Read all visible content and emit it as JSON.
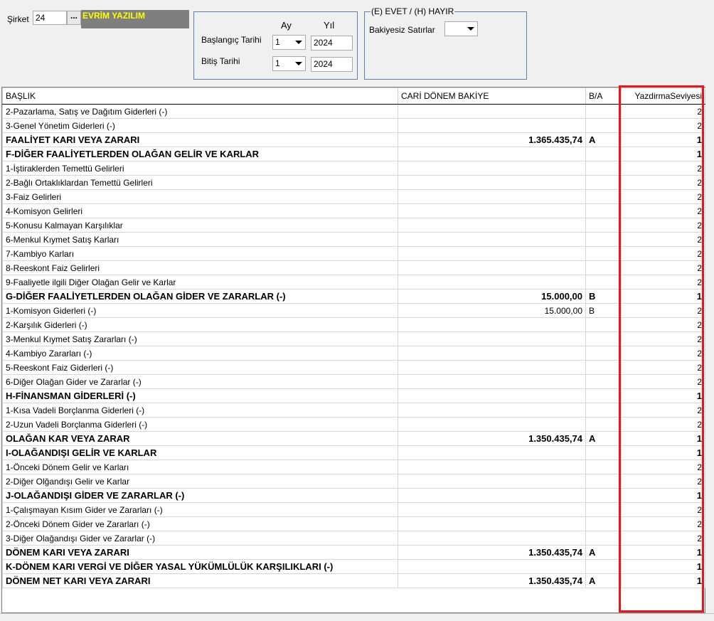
{
  "filters": {
    "sirket_label": "Şirket",
    "sirket_value": "24",
    "sirket_button": "...",
    "company_name": "EVRİM YAZILIM",
    "ay_label": "Ay",
    "yil_label": "Yıl",
    "baslangic_label": "Başlangıç Tarihi",
    "bitis_label": "Bitiş Tarihi",
    "baslangic_ay": "1",
    "baslangic_yil": "2024",
    "bitis_ay": "1",
    "bitis_yil": "2024",
    "evet_hayir_title": "(E) EVET / (H) HAYIR",
    "bakiyesiz_label": "Bakiyesiz Satırlar",
    "bakiyesiz_value": ""
  },
  "table": {
    "headers": [
      "BAŞLIK",
      "CARİ DÖNEM BAKİYE",
      "B/A",
      "YazdirmaSeviyesi"
    ],
    "rows": [
      {
        "baslik": "2-Pazarlama, Satış ve Dağıtım Giderleri (-)",
        "bakiye": "",
        "ba": "",
        "seviye": "2",
        "bold": false
      },
      {
        "baslik": "3-Genel Yönetim Giderleri (-)",
        "bakiye": "",
        "ba": "",
        "seviye": "2",
        "bold": false
      },
      {
        "baslik": "FAALİYET KARI VEYA ZARARI",
        "bakiye": "1.365.435,74",
        "ba": "A",
        "seviye": "1",
        "bold": true
      },
      {
        "baslik": "F-DİĞER FAALİYETLERDEN OLAĞAN GELİR VE KARLAR",
        "bakiye": "",
        "ba": "",
        "seviye": "1",
        "bold": true
      },
      {
        "baslik": "1-İştiraklerden Temettü Gelirleri",
        "bakiye": "",
        "ba": "",
        "seviye": "2",
        "bold": false
      },
      {
        "baslik": "2-Bağlı Ortaklıklardan Temettü Gelirleri",
        "bakiye": "",
        "ba": "",
        "seviye": "2",
        "bold": false
      },
      {
        "baslik": "3-Faiz Gelirleri",
        "bakiye": "",
        "ba": "",
        "seviye": "2",
        "bold": false
      },
      {
        "baslik": "4-Komisyon Gelirleri",
        "bakiye": "",
        "ba": "",
        "seviye": "2",
        "bold": false
      },
      {
        "baslik": "5-Konusu Kalmayan Karşılıklar",
        "bakiye": "",
        "ba": "",
        "seviye": "2",
        "bold": false
      },
      {
        "baslik": "6-Menkul Kıymet Satış Karları",
        "bakiye": "",
        "ba": "",
        "seviye": "2",
        "bold": false
      },
      {
        "baslik": "7-Kambiyo Karları",
        "bakiye": "",
        "ba": "",
        "seviye": "2",
        "bold": false
      },
      {
        "baslik": "8-Reeskont Faiz Gelirleri",
        "bakiye": "",
        "ba": "",
        "seviye": "2",
        "bold": false
      },
      {
        "baslik": "9-Faaliyetle ilgili Diğer Olağan Gelir ve Karlar",
        "bakiye": "",
        "ba": "",
        "seviye": "2",
        "bold": false
      },
      {
        "baslik": "G-DİĞER FAALİYETLERDEN OLAĞAN GİDER VE ZARARLAR (-)",
        "bakiye": "15.000,00",
        "ba": "B",
        "seviye": "1",
        "bold": true
      },
      {
        "baslik": "1-Komisyon Giderleri (-)",
        "bakiye": "15.000,00",
        "ba": "B",
        "seviye": "2",
        "bold": false
      },
      {
        "baslik": "2-Karşılık Giderleri (-)",
        "bakiye": "",
        "ba": "",
        "seviye": "2",
        "bold": false
      },
      {
        "baslik": "3-Menkul Kıymet Satış Zararları (-)",
        "bakiye": "",
        "ba": "",
        "seviye": "2",
        "bold": false
      },
      {
        "baslik": "4-Kambiyo Zararları (-)",
        "bakiye": "",
        "ba": "",
        "seviye": "2",
        "bold": false
      },
      {
        "baslik": "5-Reeskont Faiz Giderleri (-)",
        "bakiye": "",
        "ba": "",
        "seviye": "2",
        "bold": false
      },
      {
        "baslik": "6-Diğer Olağan Gider ve Zararlar (-)",
        "bakiye": "",
        "ba": "",
        "seviye": "2",
        "bold": false
      },
      {
        "baslik": "H-FİNANSMAN GİDERLERİ (-)",
        "bakiye": "",
        "ba": "",
        "seviye": "1",
        "bold": true
      },
      {
        "baslik": "1-Kısa Vadeli Borçlanma Giderleri (-)",
        "bakiye": "",
        "ba": "",
        "seviye": "2",
        "bold": false
      },
      {
        "baslik": "2-Uzun Vadeli Borçlanma Giderleri (-)",
        "bakiye": "",
        "ba": "",
        "seviye": "2",
        "bold": false
      },
      {
        "baslik": "OLAĞAN KAR VEYA ZARAR",
        "bakiye": "1.350.435,74",
        "ba": "A",
        "seviye": "1",
        "bold": true
      },
      {
        "baslik": "I-OLAĞANDIŞI GELİR VE KARLAR",
        "bakiye": "",
        "ba": "",
        "seviye": "1",
        "bold": true
      },
      {
        "baslik": "1-Önceki Dönem Gelir ve Karları",
        "bakiye": "",
        "ba": "",
        "seviye": "2",
        "bold": false
      },
      {
        "baslik": "2-Diğer Olğandışı Gelir ve Karlar",
        "bakiye": "",
        "ba": "",
        "seviye": "2",
        "bold": false
      },
      {
        "baslik": "J-OLAĞANDIŞI GİDER VE ZARARLAR (-)",
        "bakiye": "",
        "ba": "",
        "seviye": "1",
        "bold": true
      },
      {
        "baslik": "1-Çalışmayan Kısım Gider ve Zararları (-)",
        "bakiye": "",
        "ba": "",
        "seviye": "2",
        "bold": false
      },
      {
        "baslik": "2-Önceki Dönem Gider ve Zararları (-)",
        "bakiye": "",
        "ba": "",
        "seviye": "2",
        "bold": false
      },
      {
        "baslik": "3-Diğer Olağandışı Gider ve Zararlar (-)",
        "bakiye": "",
        "ba": "",
        "seviye": "2",
        "bold": false
      },
      {
        "baslik": "DÖNEM KARI VEYA ZARARI",
        "bakiye": "1.350.435,74",
        "ba": "A",
        "seviye": "1",
        "bold": true
      },
      {
        "baslik": "K-DÖNEM KARI VERGİ VE DİĞER YASAL YÜKÜMLÜLÜK KARŞILIKLARI (-)",
        "bakiye": "",
        "ba": "",
        "seviye": "1",
        "bold": true
      },
      {
        "baslik": "DÖNEM NET KARI VEYA ZARARI",
        "bakiye": "1.350.435,74",
        "ba": "A",
        "seviye": "1",
        "bold": true
      }
    ]
  },
  "colors": {
    "highlight": "#e8161b",
    "company_bg": "#7f7f7f",
    "company_fg": "#ffff00",
    "groupbox_border": "#5b7fb5"
  }
}
